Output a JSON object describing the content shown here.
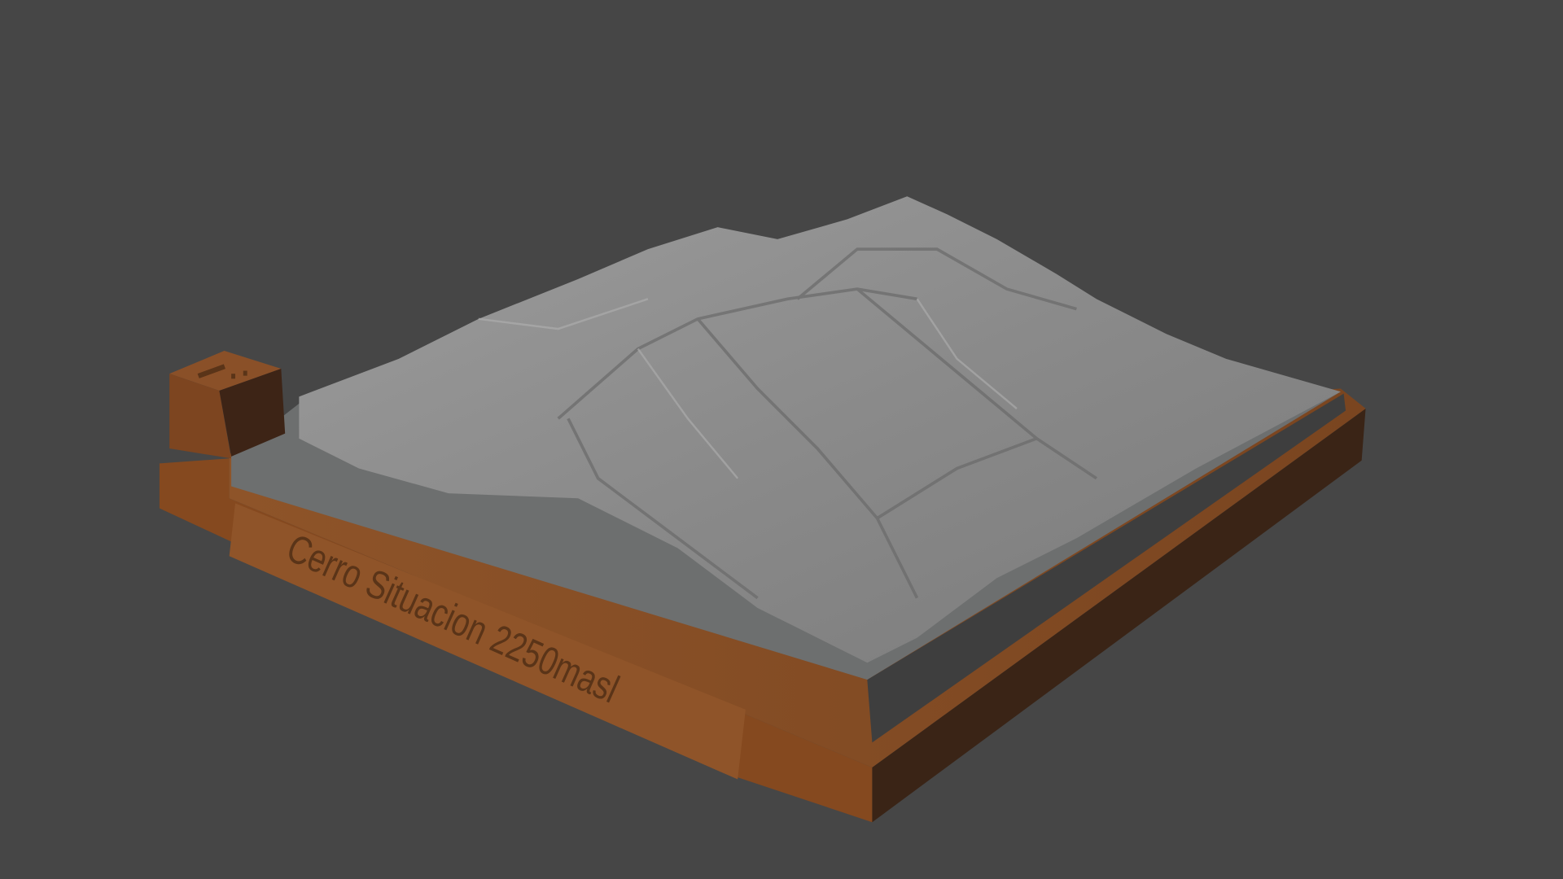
{
  "scene": {
    "background_color": "#464646",
    "base_color": "#8a4f27",
    "terrain_color": "#8e8e8e",
    "plate_label": "Cerro Situacion 2250masl"
  }
}
